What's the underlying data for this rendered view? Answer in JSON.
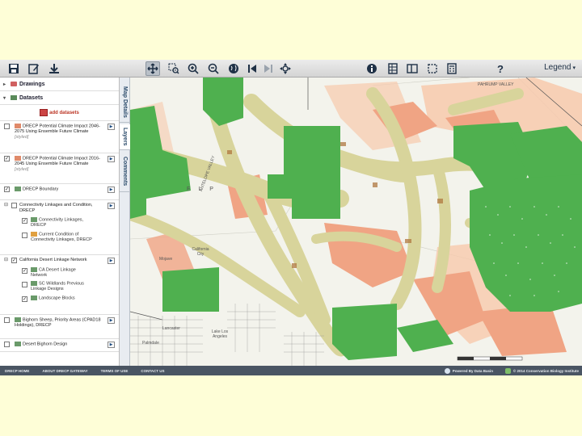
{
  "toolbar": {
    "legend_label": "Legend",
    "icons": [
      "save-icon",
      "edit-icon",
      "download-icon",
      "pan-icon",
      "zoom-box-icon",
      "zoom-in-icon",
      "zoom-out-icon",
      "globe-icon",
      "previous-extent-icon",
      "next-extent-icon",
      "full-extent-icon",
      "info-icon",
      "table-icon",
      "split-view-icon",
      "select-icon",
      "calculator-icon",
      "help-icon"
    ]
  },
  "panel": {
    "drawings_label": "Drawings",
    "datasets_label": "Datasets",
    "add_datasets_label": "add datasets",
    "layers": [
      {
        "name": "DRECP Potential Climate Impact 2046-2075 Using Ensemble Future Climate",
        "styled": "[styled]",
        "checked": false
      },
      {
        "name": "DRECP Potential Climate Impact 2016-2045 Using Ensemble Future Climate",
        "styled": "[styled]",
        "checked": true
      },
      {
        "name": "DRECP Boundary",
        "checked": true
      },
      {
        "name": "Connectivity Linkages and Condition, DRECP",
        "checked": false,
        "children": [
          {
            "name": "Connectivity Linkages, DRECP",
            "checked": true
          },
          {
            "name": "Current Condition of Connectivity Linkages, DRECP",
            "checked": false
          }
        ]
      },
      {
        "name": "California Desert Linkage Network",
        "checked": true,
        "children": [
          {
            "name": "CA Desert Linkage Network",
            "checked": true
          },
          {
            "name": "SC Wildlands Previous Linkage Designs",
            "checked": false
          },
          {
            "name": "Landscape Blocks",
            "checked": true
          }
        ]
      },
      {
        "name": "Bighorn Sheep, Priority Areas (CPAD18 Holdings), DRECP",
        "checked": false
      },
      {
        "name": "Desert Bighorn Design",
        "checked": false
      }
    ]
  },
  "tabs": [
    "Map Details",
    "Layers",
    "Comments"
  ],
  "map": {
    "labels": {
      "pahrump": "PAHRUMP VALLEY",
      "antelope": "ANTELOPE VALLEY",
      "california_city": "California City",
      "mojave": "Mojave",
      "lancaster": "Lancaster",
      "palmdale": "Palmdale",
      "lake_los_angeles": "Lake Los Angeles",
      "elp": "E L P"
    },
    "colors": {
      "base": "#f3f3ec",
      "green": "#4fb04f",
      "tan": "#d8d49b",
      "salmon": "#f0a484",
      "light_salmon": "#f7c9ad",
      "brown": "#b07840"
    }
  },
  "footer": {
    "links": [
      "DRECP HOME",
      "ABOUT DRECP GATEWAY",
      "TERMS OF USE",
      "CONTACT US"
    ],
    "powered_by": "Powered By Data Basin",
    "copyright": "© 2014 Conservation Biology Institute"
  }
}
